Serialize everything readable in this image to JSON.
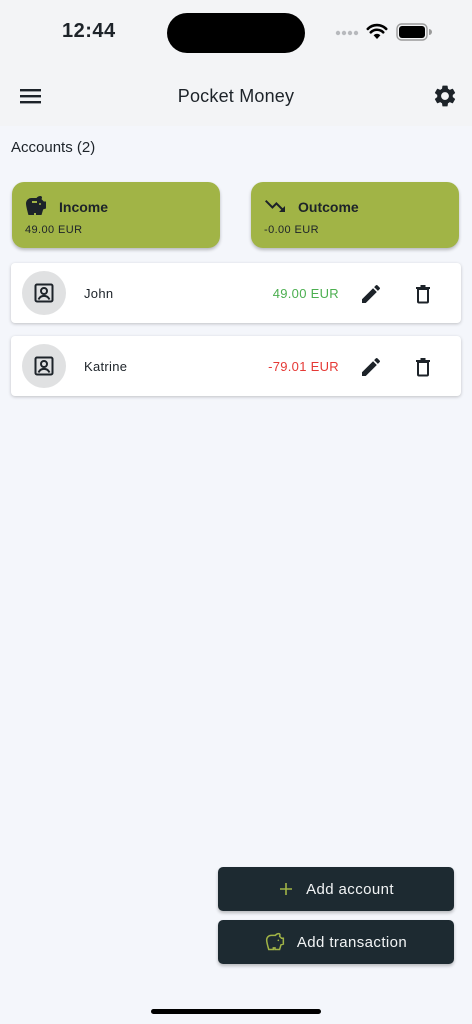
{
  "status_bar": {
    "time": "12:44"
  },
  "app_bar": {
    "title": "Pocket Money",
    "menu_icon": "menu-icon",
    "settings_icon": "gear-icon"
  },
  "accounts_section": {
    "title": "Accounts (2)"
  },
  "summary": {
    "income": {
      "label": "Income",
      "value": "49.00 EUR",
      "icon": "piggy-bank-icon"
    },
    "outcome": {
      "label": "Outcome",
      "value": "-0.00 EUR",
      "icon": "trending-down-icon"
    }
  },
  "accounts": [
    {
      "name": "John",
      "balance": "49.00 EUR",
      "balance_color": "#4caf50"
    },
    {
      "name": "Katrine",
      "balance": "-79.01 EUR",
      "balance_color": "#e53935"
    }
  ],
  "actions": {
    "add_account": "Add account",
    "add_transaction": "Add transaction"
  },
  "colors": {
    "accent_card": "#a1b446",
    "button_dark": "#1d2a31",
    "icon_accent": "#a1b446",
    "positive": "#4caf50",
    "negative": "#e53935"
  }
}
